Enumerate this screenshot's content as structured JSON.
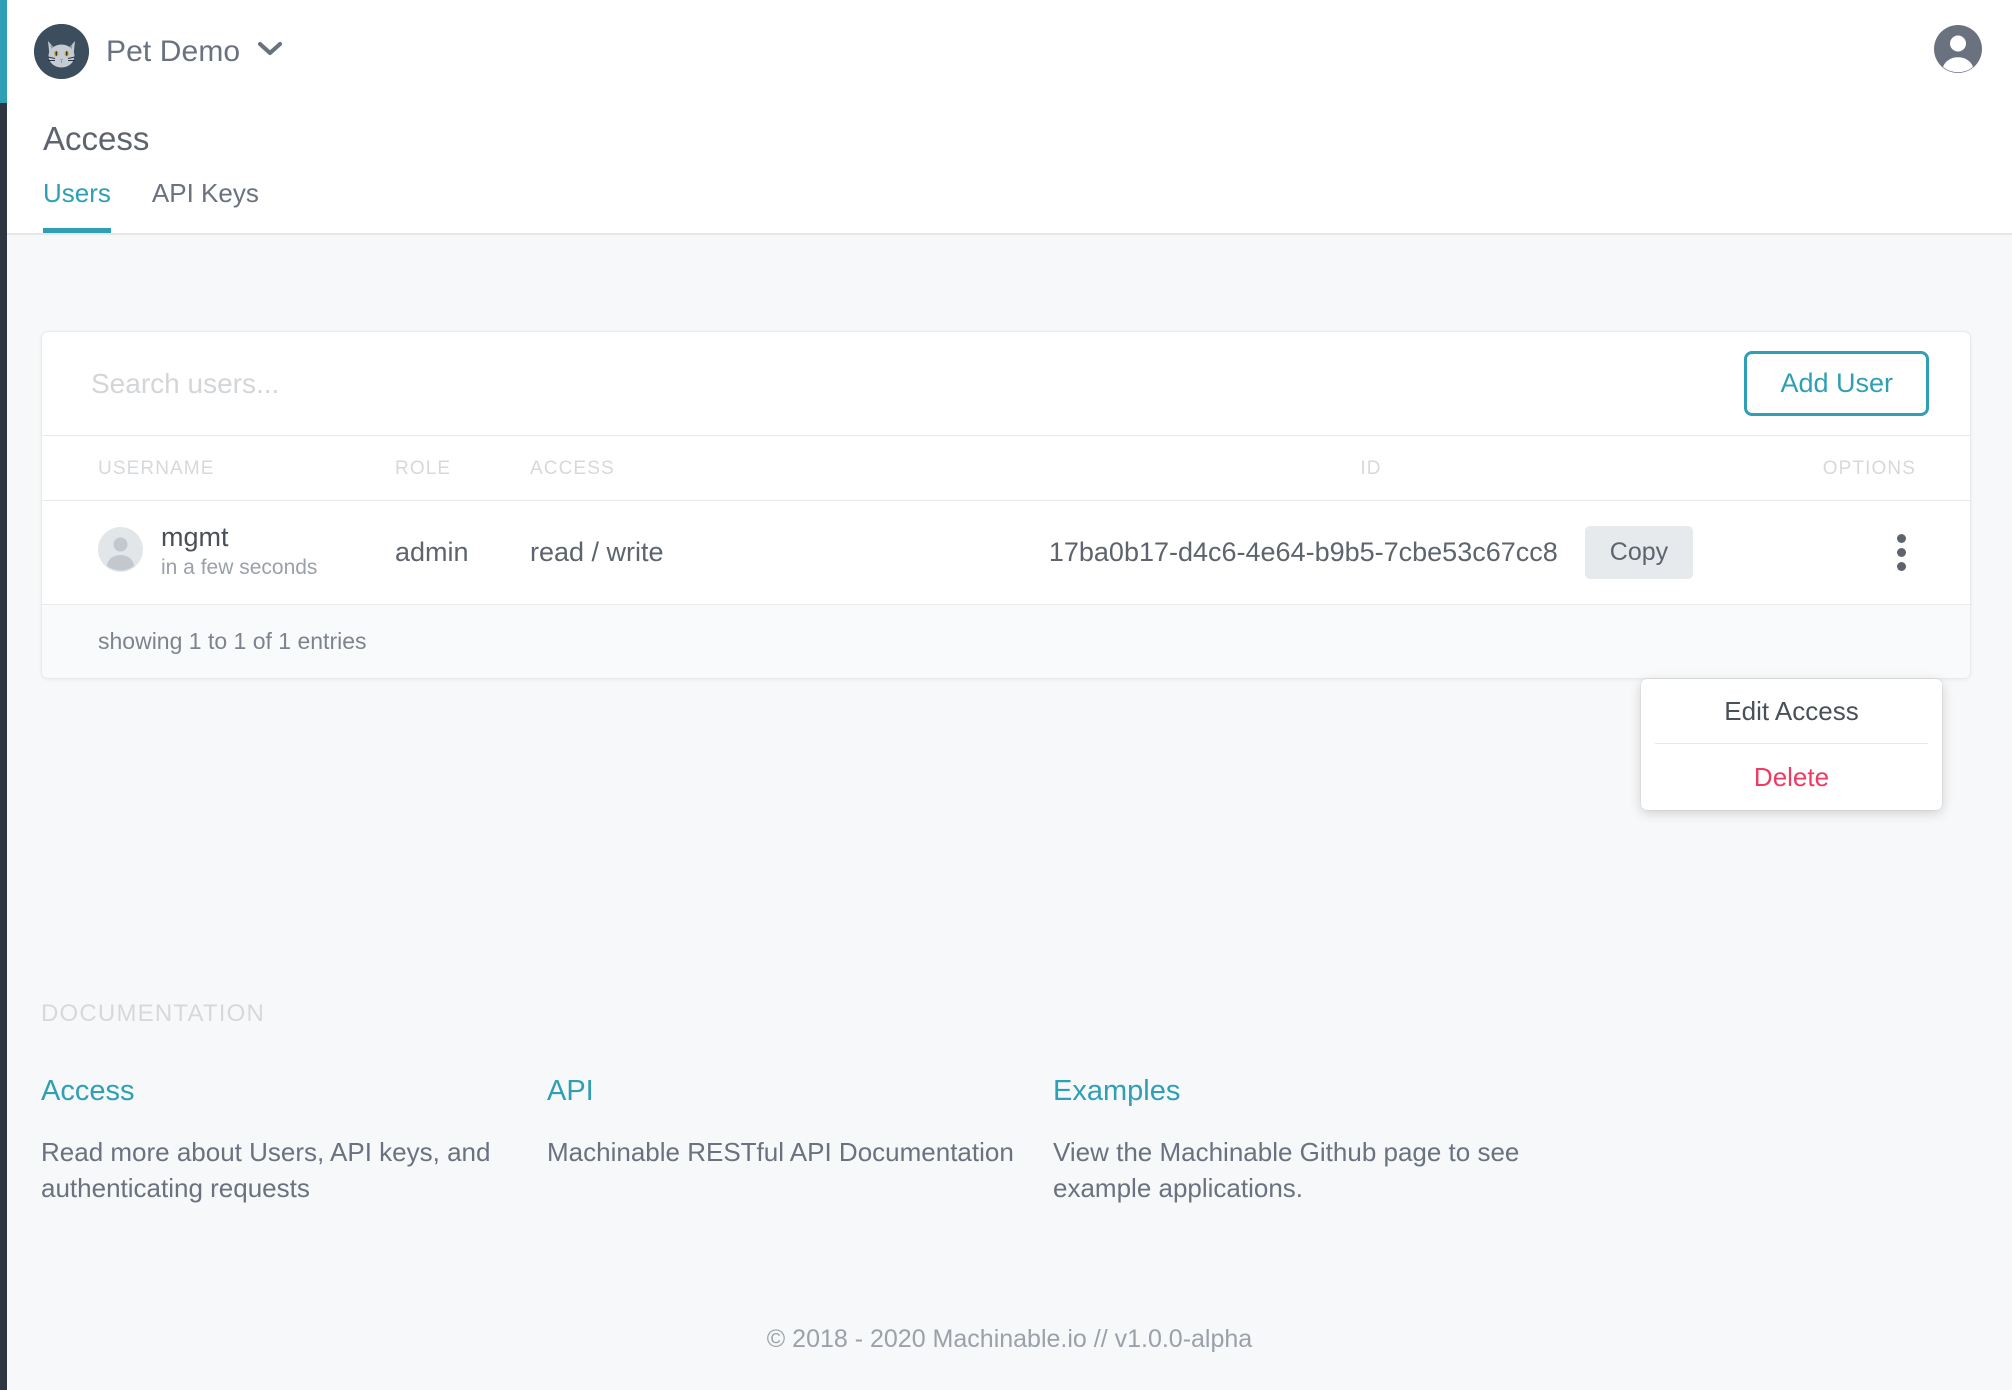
{
  "theme": {
    "accent": "#2f9fb5",
    "danger": "#ef3b63",
    "dark_rail": "#2e3642",
    "text": "#5d646e",
    "muted": "#9aa1a9",
    "page_bg": "#f7f8f9"
  },
  "topbar": {
    "project_name": "Pet Demo",
    "project_avatar_icon": "cat-avatar-icon",
    "project_dropdown_icon": "chevron-down-icon",
    "account_icon": "account-circle-icon"
  },
  "page": {
    "title": "Access",
    "tabs": [
      {
        "label": "Users",
        "active": true
      },
      {
        "label": "API Keys",
        "active": false
      }
    ]
  },
  "toolbar": {
    "search_placeholder": "Search users...",
    "search_value": "",
    "search_icon": "search-input",
    "add_user_label": "Add User"
  },
  "table": {
    "columns": [
      {
        "key": "username",
        "label": "USERNAME"
      },
      {
        "key": "role",
        "label": "ROLE"
      },
      {
        "key": "access",
        "label": "ACCESS"
      },
      {
        "key": "id",
        "label": "ID"
      },
      {
        "key": "options",
        "label": "OPTIONS"
      }
    ],
    "rows": [
      {
        "avatar_icon": "user-avatar-icon",
        "username": "mgmt",
        "created": "in a few seconds",
        "role": "admin",
        "access": "read / write",
        "id": "17ba0b17-d4c6-4e64-b9b5-7cbe53c67cc8",
        "copy_label": "Copy",
        "options_icon": "kebab-menu-icon"
      }
    ],
    "entries_text": "showing 1 to 1 of 1 entries"
  },
  "dropdown": {
    "open": true,
    "items": [
      {
        "label": "Edit Access",
        "danger": false
      },
      {
        "label": "Delete",
        "danger": true
      }
    ]
  },
  "docs": {
    "section_label": "DOCUMENTATION",
    "columns": [
      {
        "title": "Access",
        "description": "Read more about Users, API keys, and authenticating requests"
      },
      {
        "title": "API",
        "description": "Machinable RESTful API Documentation"
      },
      {
        "title": "Examples",
        "description": "View the Machinable Github page to see example applications."
      }
    ]
  },
  "footer": {
    "text": "© 2018 - 2020 Machinable.io // v1.0.0-alpha"
  }
}
